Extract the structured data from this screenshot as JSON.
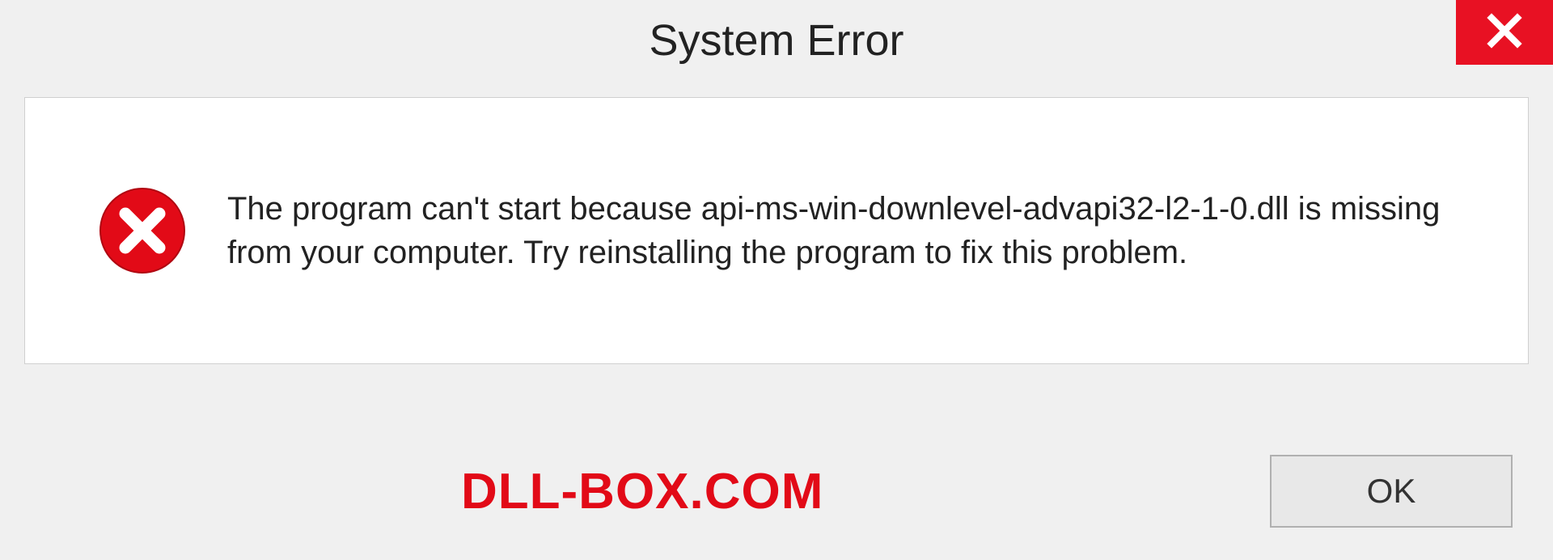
{
  "dialog": {
    "title": "System Error",
    "message": "The program can't start because api-ms-win-downlevel-advapi32-l2-1-0.dll is missing from your computer. Try reinstalling the program to fix this problem.",
    "ok_label": "OK"
  },
  "watermark": "DLL-BOX.COM",
  "colors": {
    "close_bg": "#e81123",
    "error_red": "#e20a17",
    "panel_bg": "#ffffff",
    "window_bg": "#f0f0f0"
  },
  "icons": {
    "close": "close-icon",
    "error": "error-circle-x-icon"
  }
}
